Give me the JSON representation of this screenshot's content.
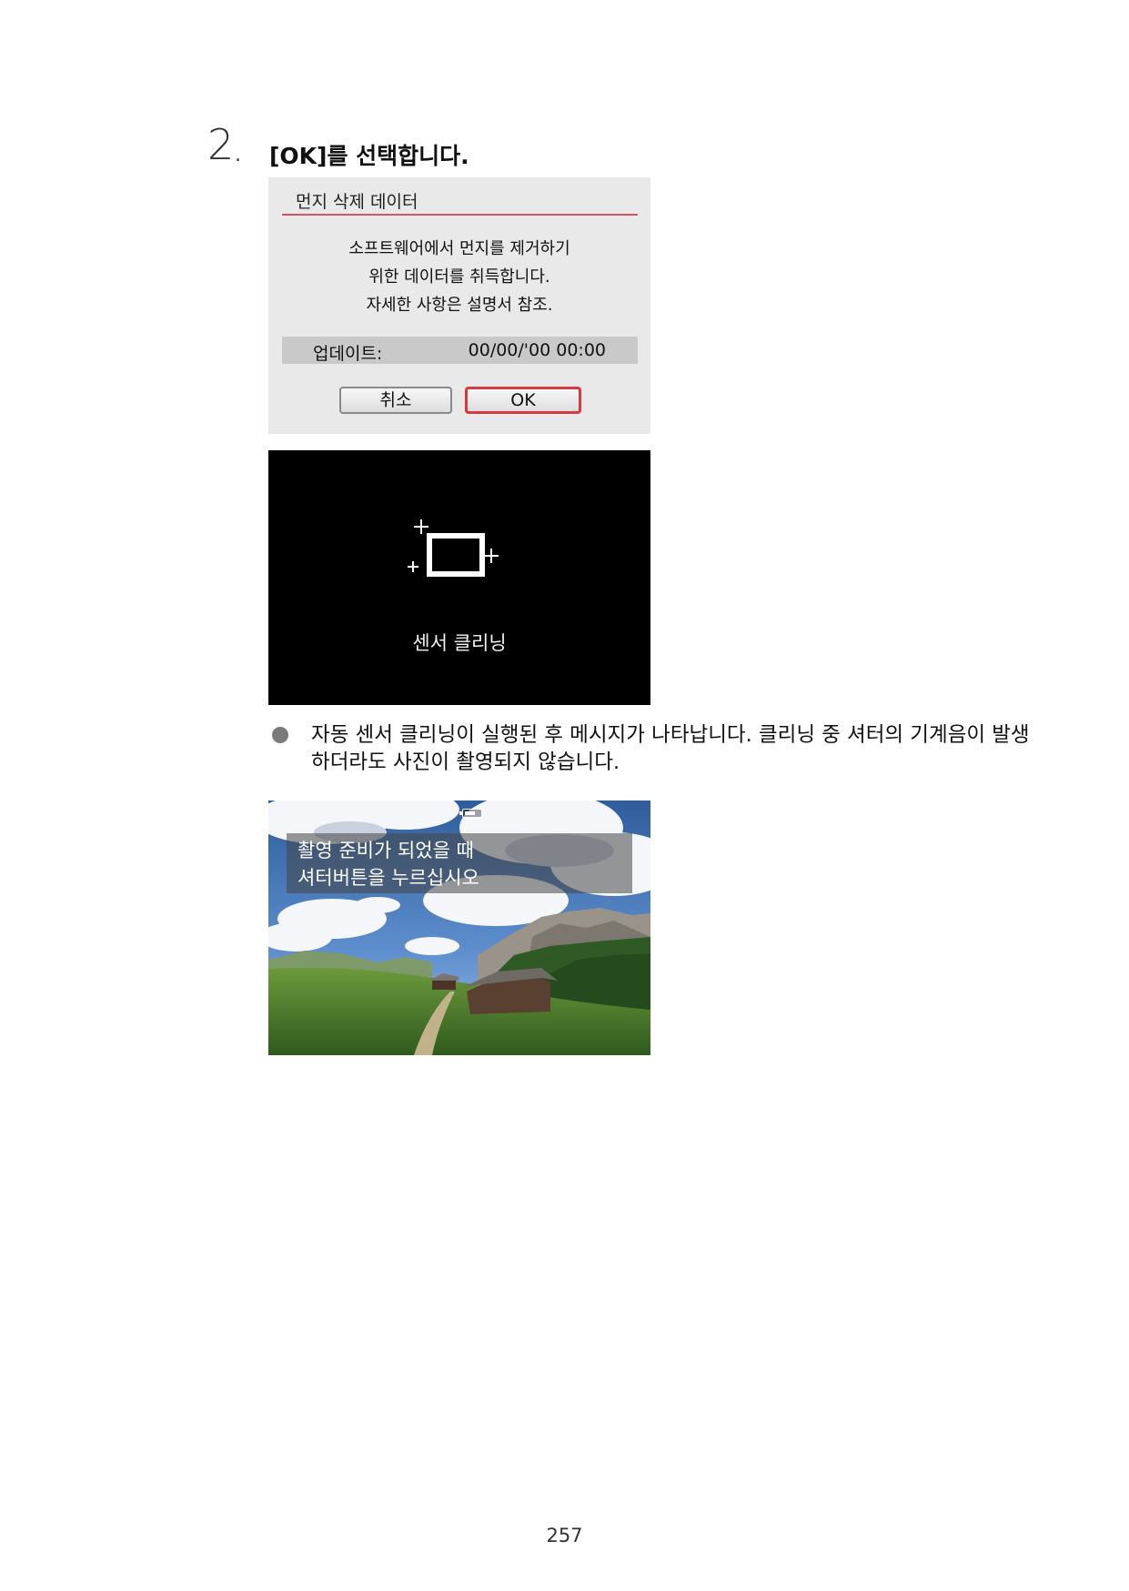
{
  "step": {
    "number": "2",
    "title": "[OK]를 선택합니다."
  },
  "dialog": {
    "title": "먼지 삭제 데이터",
    "body_lines": [
      "소프트웨어에서 먼지를 제거하기",
      "위한 데이터를 취득합니다.",
      "자세한 사항은 설명서 참조."
    ],
    "update_label": "업데이트:",
    "update_value": "00/00/'00  00:00",
    "cancel_label": "취소",
    "ok_label": "OK",
    "accent_color": "#d63a41"
  },
  "cleaning_screen": {
    "label": "센서 클리닝",
    "icon": "sensor-cleaning-icon"
  },
  "bullet": {
    "text": "자동 센서 클리닝이 실행된 후 메시지가 나타납니다. 클리닝 중 셔터의 기계음이 발생하더라도 사진이 촬영되지 않습니다."
  },
  "live_view": {
    "message_lines": [
      "촬영 준비가 되었을 때",
      "셔터버튼을 누르십시오"
    ],
    "battery_level": 0.75,
    "battery_icon": "battery-icon"
  },
  "page_number": "257"
}
